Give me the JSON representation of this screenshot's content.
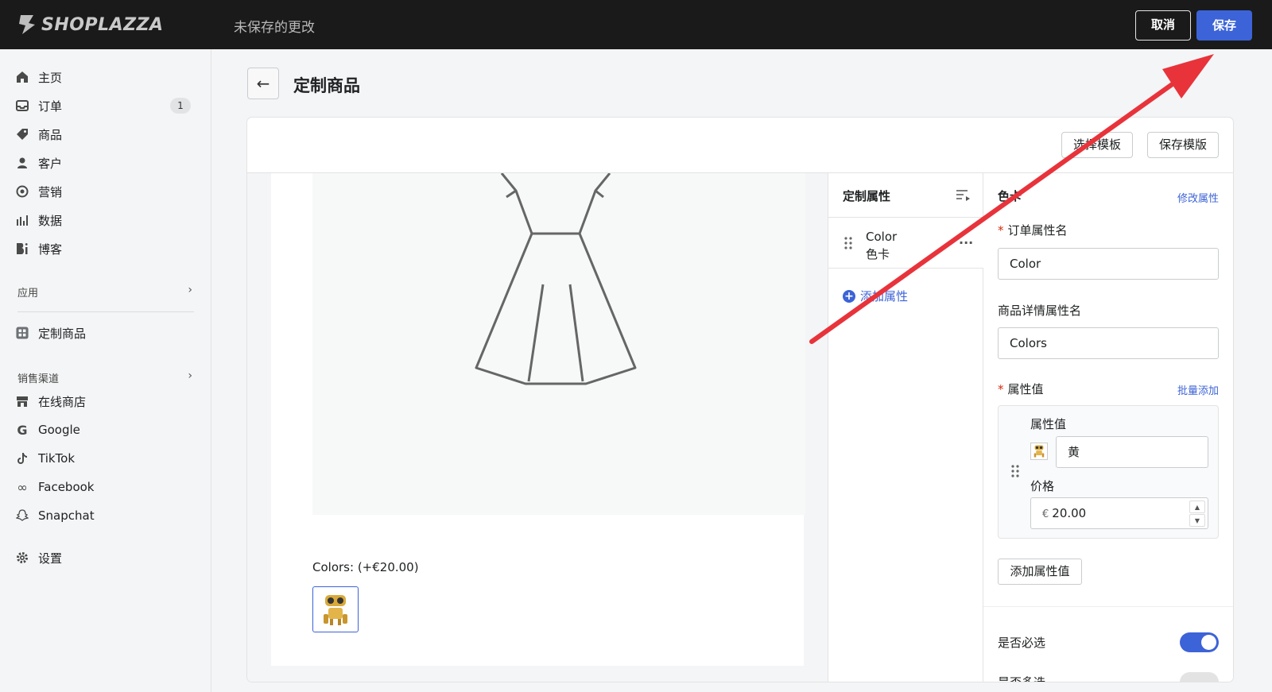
{
  "topbar": {
    "logo_text": "SHOPLAZZA",
    "unsaved_label": "未保存的更改",
    "cancel_label": "取消",
    "save_label": "保存"
  },
  "sidebar": {
    "items": [
      {
        "label": "主页",
        "icon": "home-icon"
      },
      {
        "label": "订单",
        "icon": "inbox-icon",
        "badge": "1"
      },
      {
        "label": "商品",
        "icon": "tag-icon"
      },
      {
        "label": "客户",
        "icon": "person-icon"
      },
      {
        "label": "营销",
        "icon": "target-icon"
      },
      {
        "label": "数据",
        "icon": "bar-chart-icon"
      },
      {
        "label": "博客",
        "icon": "blog-icon"
      }
    ],
    "apps_header": "应用",
    "app_item": {
      "label": "定制商品",
      "icon": "app-grid-icon"
    },
    "channels_header": "销售渠道",
    "channels": [
      {
        "label": "在线商店",
        "icon": "store-icon"
      },
      {
        "label": "Google",
        "icon": "google-icon"
      },
      {
        "label": "TikTok",
        "icon": "tiktok-icon"
      },
      {
        "label": "Facebook",
        "icon": "meta-icon"
      },
      {
        "label": "Snapchat",
        "icon": "snapchat-icon"
      }
    ],
    "settings_label": "设置"
  },
  "page": {
    "title": "定制商品"
  },
  "toolbar": {
    "choose_template_label": "选择模板",
    "save_template_label": "保存模版"
  },
  "preview": {
    "colors_label": "Colors:",
    "colors_price": "(+€20.00)"
  },
  "attributes": {
    "header": "定制属性",
    "items": [
      {
        "name": "Color",
        "type": "色卡"
      }
    ],
    "add_label": "添加属性"
  },
  "properties": {
    "type_label": "色卡",
    "edit_link": "修改属性",
    "order_attr_label": "订单属性名",
    "order_attr_value": "Color",
    "detail_attr_label": "商品详情属性名",
    "detail_attr_value": "Colors",
    "values_label": "属性值",
    "bulk_add_link": "批量添加",
    "value_item": {
      "value_label": "属性值",
      "value": "黄",
      "price_label": "价格",
      "currency": "€",
      "price": "20.00"
    },
    "add_value_label": "添加属性值",
    "required_label": "是否必选",
    "required_on": true,
    "multi_label": "是否多选",
    "multi_on": false
  },
  "colors": {
    "accent": "#3c63d7",
    "topbar": "#1a1a1a",
    "annotation_arrow": "#e8333b"
  }
}
